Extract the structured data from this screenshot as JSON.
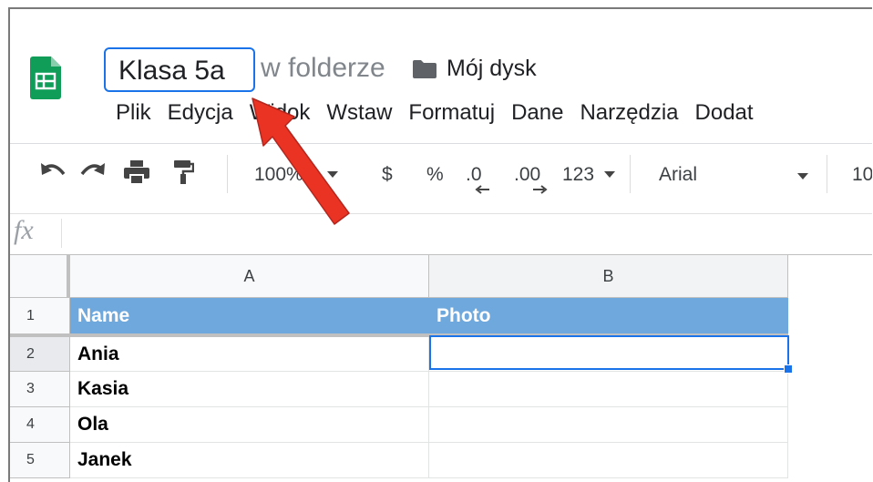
{
  "document": {
    "title": "Klasa 5a",
    "location_prefix": "w folderze",
    "folder": "Mój dysk"
  },
  "menu": [
    "Plik",
    "Edycja",
    "Widok",
    "Wstaw",
    "Formatuj",
    "Dane",
    "Narzędzia",
    "Dodat"
  ],
  "toolbar": {
    "zoom": "100%",
    "currency": "$",
    "percent": "%",
    "decrease_decimals": ".0",
    "increase_decimals": ".00",
    "number_format": "123",
    "font": "Arial",
    "font_size": "10"
  },
  "formula_bar": {
    "label": "fx"
  },
  "sheet": {
    "columns": [
      "A",
      "B"
    ],
    "rows": [
      {
        "num": "1",
        "a": "Name",
        "b": "Photo"
      },
      {
        "num": "2",
        "a": "Ania",
        "b": ""
      },
      {
        "num": "3",
        "a": "Kasia",
        "b": ""
      },
      {
        "num": "4",
        "a": "Ola",
        "b": ""
      },
      {
        "num": "5",
        "a": "Janek",
        "b": ""
      }
    ]
  },
  "colors": {
    "accent": "#1a73e8",
    "header_fill": "#6fa8dc",
    "logo_green": "#0f9d58",
    "annotation_arrow": "#ea3323"
  },
  "icons": [
    "sheets-logo-icon",
    "folder-icon",
    "undo-icon",
    "redo-icon",
    "print-icon",
    "paint-format-icon",
    "dropdown-icon",
    "annotation-arrow-icon"
  ]
}
